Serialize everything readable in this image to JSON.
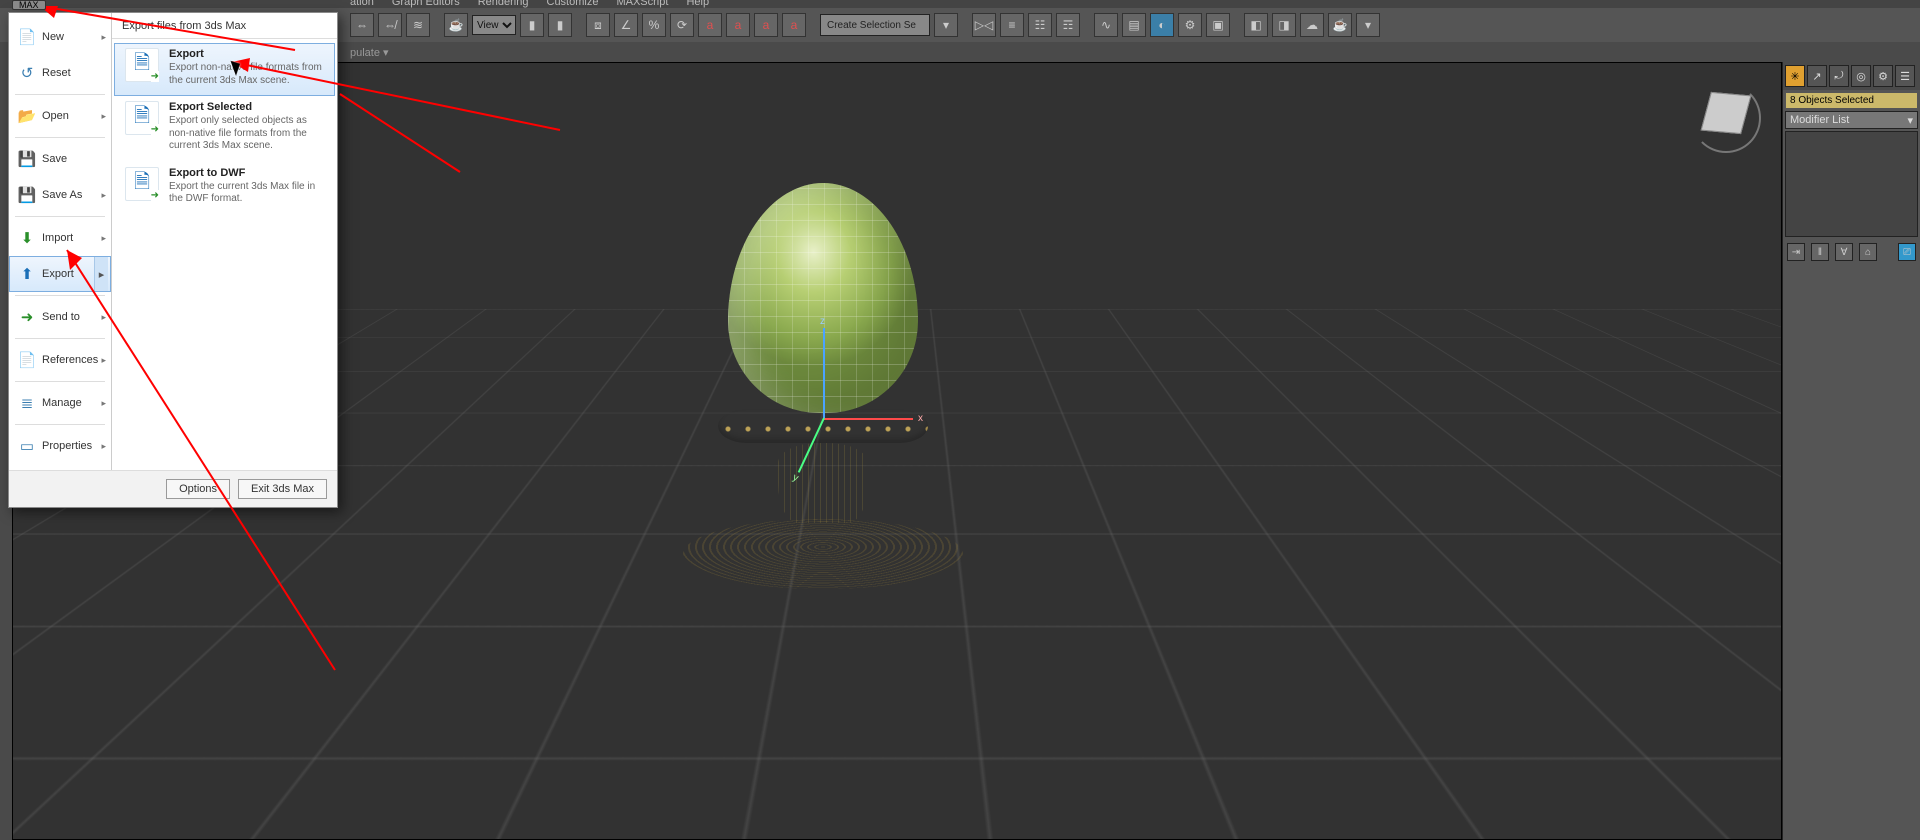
{
  "menubar": {
    "items": [
      "ation",
      "Graph Editors",
      "Rendering",
      "Customize",
      "MAXScript",
      "Help"
    ]
  },
  "toolbar": {
    "view_label": "View",
    "selection_placeholder": "Create Selection Se"
  },
  "inforow": {
    "text": "pulate ▾"
  },
  "max_chip": "MAX",
  "appmenu": {
    "left": [
      {
        "icon": "📄",
        "cls": "ic-doc",
        "label": "New",
        "chev": true
      },
      {
        "icon": "↺",
        "cls": "ic-reset",
        "label": "Reset",
        "chev": false
      },
      {
        "sep": true
      },
      {
        "icon": "📂",
        "cls": "ic-open",
        "label": "Open",
        "chev": true
      },
      {
        "sep": true
      },
      {
        "icon": "💾",
        "cls": "ic-save",
        "label": "Save",
        "chev": false
      },
      {
        "icon": "💾",
        "cls": "ic-save",
        "label": "Save As",
        "chev": true
      },
      {
        "sep": true
      },
      {
        "icon": "⬇",
        "cls": "ic-imp",
        "label": "Import",
        "chev": true
      },
      {
        "icon": "⬆",
        "cls": "ic-exp",
        "label": "Export",
        "chev": true,
        "hl": true
      },
      {
        "sep": true
      },
      {
        "icon": "➜",
        "cls": "ic-imp",
        "label": "Send to",
        "chev": true
      },
      {
        "sep": true
      },
      {
        "icon": "📄",
        "cls": "ic-ref",
        "label": "References",
        "chev": true
      },
      {
        "sep": true
      },
      {
        "icon": "≣",
        "cls": "ic-man",
        "label": "Manage",
        "chev": true
      },
      {
        "sep": true
      },
      {
        "icon": "▭",
        "cls": "ic-prop",
        "label": "Properties",
        "chev": true
      }
    ],
    "right_title": "Export files from 3ds Max",
    "right": [
      {
        "title": "Export",
        "desc": "Export non-native file formats from the current 3ds Max scene.",
        "hl": true
      },
      {
        "title": "Export Selected",
        "desc": "Export only selected objects as non-native file formats from the current 3ds Max scene."
      },
      {
        "title": "Export to DWF",
        "desc": "Export the current 3ds Max file in the DWF format."
      }
    ],
    "footer": {
      "options": "Options",
      "exit": "Exit 3ds Max"
    }
  },
  "cmdpanel": {
    "tabs": [
      "✳",
      "↗",
      "⤾",
      "◎",
      "⚙",
      "☰"
    ],
    "sel_info": "8 Objects Selected",
    "modlist_label": "Modifier List",
    "mod_buttons": [
      "⇥",
      "‖",
      "∀",
      "⌂",
      "⎚"
    ]
  }
}
